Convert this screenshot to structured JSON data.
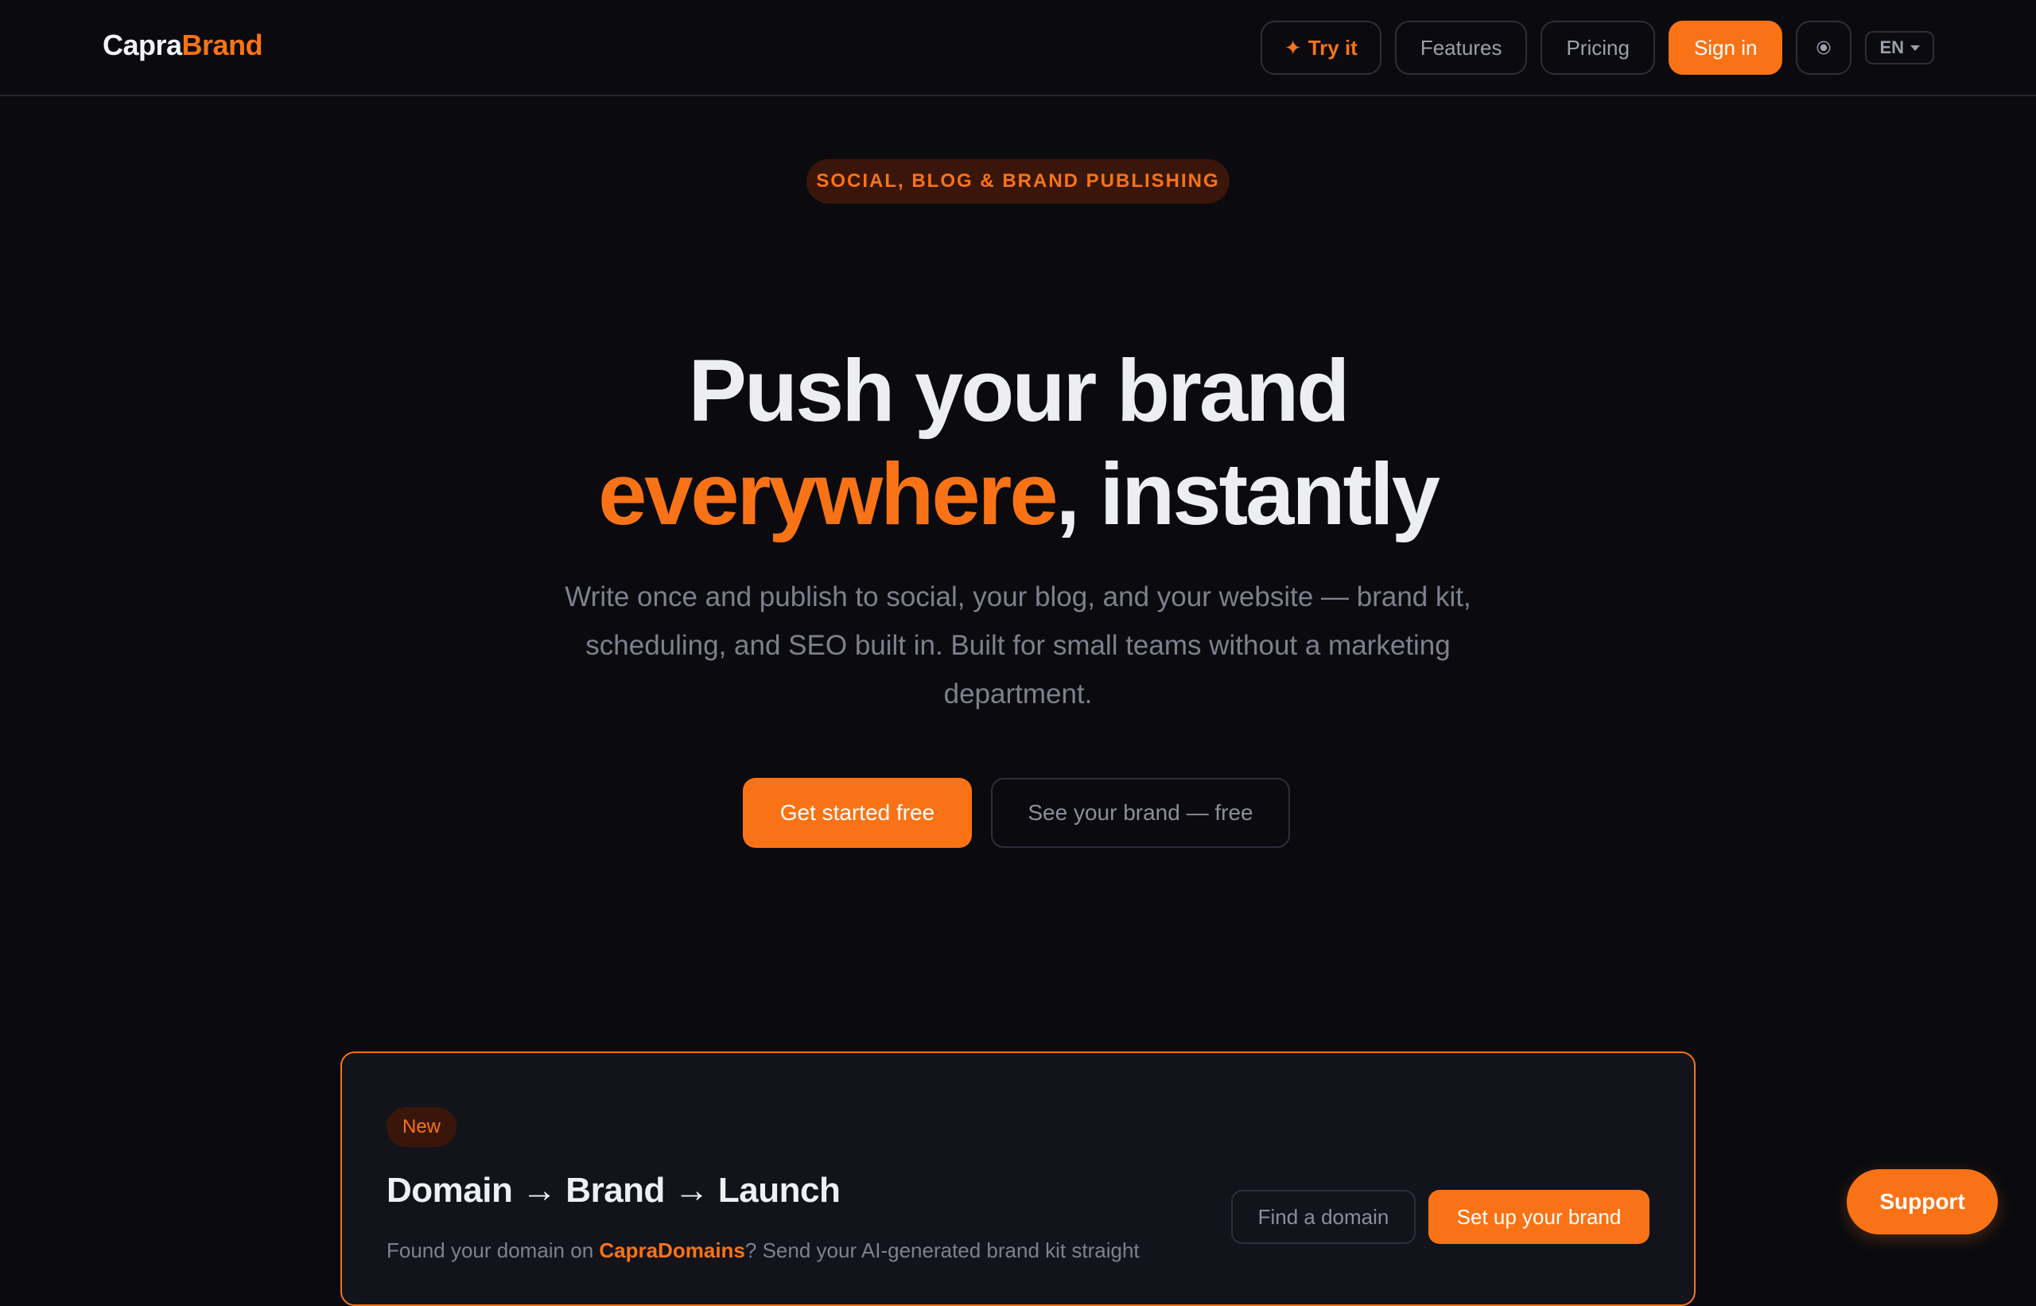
{
  "brand": {
    "name_part1": "Capra",
    "name_part2": "Brand"
  },
  "nav": {
    "try_label": "Try it",
    "features_label": "Features",
    "pricing_label": "Pricing",
    "signin_label": "Sign in",
    "language": "EN"
  },
  "hero": {
    "eyebrow": "SOCIAL, BLOG & BRAND PUBLISHING",
    "title_line1": "Push your brand",
    "title_accent": "everywhere",
    "title_rest": ", instantly",
    "lead": "Write once and publish to social, your blog, and your website — brand kit, scheduling, and SEO built in. Built for small teams without a marketing department.",
    "cta_primary": "Get started free",
    "cta_secondary": "See your brand — free"
  },
  "promo": {
    "badge": "New",
    "title": "Domain → Brand → Launch",
    "desc_before": "Found your domain on ",
    "desc_link": "CapraDomains",
    "desc_after": "? Send your AI-generated brand kit straight",
    "find_domain_label": "Find a domain",
    "setup_brand_label": "Set up your brand"
  },
  "support_label": "Support",
  "colors": {
    "accent": "#f97316",
    "background": "#0b0b0f",
    "card": "#13141b"
  },
  "icons": {
    "try": "sparkle-icon",
    "theme": "sun-icon",
    "language_caret": "chevron-down-icon"
  }
}
